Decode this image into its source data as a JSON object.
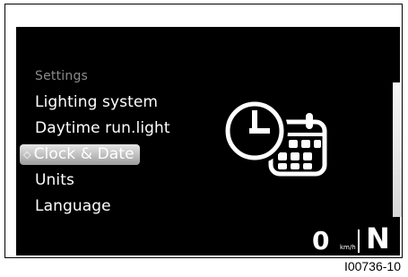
{
  "menu": {
    "heading": "Settings",
    "items": [
      {
        "label": "Lighting system"
      },
      {
        "label": "Daytime run.light"
      },
      {
        "label": "Clock & Date",
        "selected": true
      },
      {
        "label": "Units"
      },
      {
        "label": "Language"
      }
    ],
    "selected_marker": "◇"
  },
  "status": {
    "speed": "0",
    "speed_unit": "km/h",
    "gear": "N"
  },
  "icon": {
    "center": "clock-calendar-icon"
  },
  "figure_code": "I00736-10",
  "colors": {
    "screen_background": "#000000",
    "text": "#ffffff",
    "heading_text": "#8a8a8a",
    "selection_highlight": "#bcbcbc"
  }
}
